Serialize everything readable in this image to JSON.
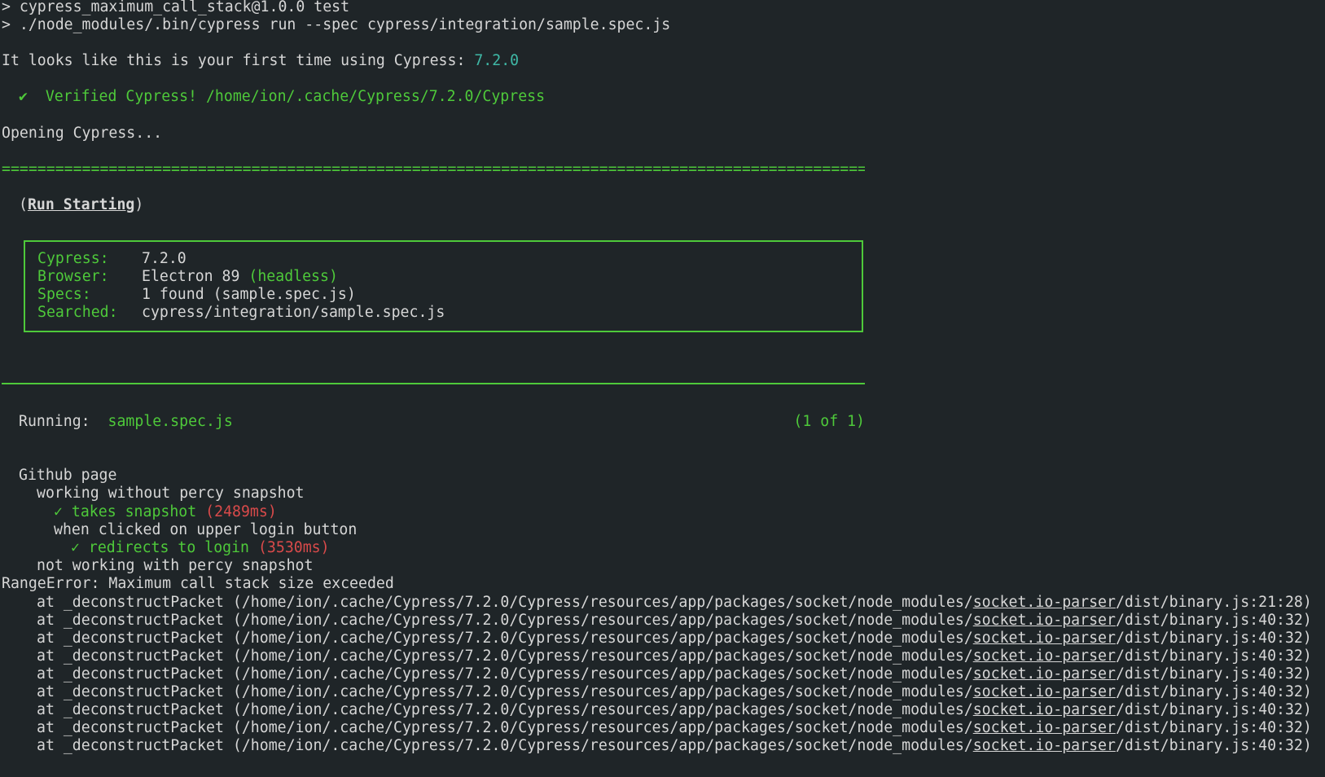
{
  "terminal": {
    "cmd_line_1": "> cypress_maximum_call_stack@1.0.0 test",
    "cmd_line_2": "> ./node_modules/.bin/cypress run --spec cypress/integration/sample.spec.js",
    "first_time_prefix": "It looks like this is your first time using Cypress: ",
    "first_time_version": "7.2.0",
    "verified_check": "✔",
    "verified_text": "Verified Cypress!",
    "verified_path": "/home/ion/.cache/Cypress/7.2.0/Cypress",
    "opening": "Opening Cypress...",
    "separator": "====================================================================================================",
    "run_starting_open": "(",
    "run_starting_label": "Run Starting",
    "run_starting_close": ")",
    "info_rows": [
      {
        "key": "Cypress:",
        "value": "7.2.0",
        "extra": ""
      },
      {
        "key": "Browser:",
        "value": "Electron 89 ",
        "extra": "(headless)"
      },
      {
        "key": "Specs:",
        "value": "1 found (sample.spec.js)",
        "extra": ""
      },
      {
        "key": "Searched:",
        "value": "cypress/integration/sample.spec.js",
        "extra": ""
      }
    ],
    "running_label": "Running:",
    "running_spec": "sample.spec.js",
    "running_count": "(1 of 1)",
    "suite_title": "Github page",
    "context_1": "working without percy snapshot",
    "test_1_check": "✓",
    "test_1_name": "takes snapshot",
    "test_1_time": "(2489ms)",
    "context_2": "when clicked on upper login button",
    "test_2_check": "✓",
    "test_2_name": "redirects to login",
    "test_2_time": "(3530ms)",
    "context_3": "not working with percy snapshot",
    "error_line": "RangeError: Maximum call stack size exceeded",
    "stack_prefix": "at _deconstructPacket (/home/ion/.cache/Cypress/7.2.0/Cypress/resources/app/packages/socket/node_modules/",
    "stack_link": "socket.io-parser",
    "stack_frames": [
      "/dist/binary.js:21:28)",
      "/dist/binary.js:40:32)",
      "/dist/binary.js:40:32)",
      "/dist/binary.js:40:32)",
      "/dist/binary.js:40:32)",
      "/dist/binary.js:40:32)",
      "/dist/binary.js:40:32)",
      "/dist/binary.js:40:32)",
      "/dist/binary.js:40:32)"
    ]
  },
  "colors": {
    "background": "#1f2528",
    "text": "#d6d6d6",
    "green": "#4ec93a",
    "cyan": "#3fb8a6",
    "red": "#d94a4a"
  }
}
